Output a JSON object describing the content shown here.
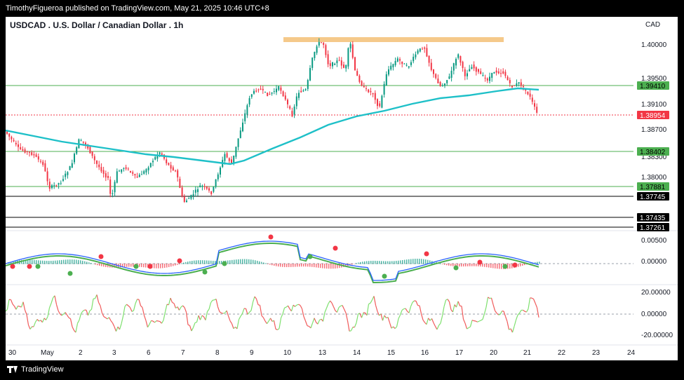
{
  "header": {
    "publisher_line": "TimothyFigueroa published on TradingView.com, May 21, 2025 10:46 UTC+8"
  },
  "chart": {
    "title": "USDCAD . U.S. Dollar / Canadian Dollar . 1h",
    "currency": "CAD",
    "price_ticks": [
      "1.40000",
      "1.39500",
      "1.39100",
      "1.38700",
      "1.38300",
      "1.38000"
    ],
    "level_labels": [
      {
        "text": "1.39410",
        "bg": "#4caf50",
        "fg": "#000000"
      },
      {
        "text": "1.38954",
        "bg": "#f23645",
        "fg": "#ffffff"
      },
      {
        "text": "1.38402",
        "bg": "#4caf50",
        "fg": "#000000"
      },
      {
        "text": "1.37881",
        "bg": "#4caf50",
        "fg": "#000000"
      },
      {
        "text": "1.37745",
        "bg": "#000000",
        "fg": "#ffffff"
      },
      {
        "text": "1.37435",
        "bg": "#000000",
        "fg": "#ffffff"
      },
      {
        "text": "1.37261",
        "bg": "#000000",
        "fg": "#ffffff"
      }
    ],
    "macd_ticks": [
      "0.00500",
      "0.00000"
    ],
    "osc_ticks": [
      "20.00000",
      "0.00000",
      "-20.00000"
    ],
    "time_labels": [
      "30",
      "May",
      "2",
      "3",
      "6",
      "7",
      "8",
      "9",
      "10",
      "13",
      "14",
      "15",
      "16",
      "17",
      "20",
      "21",
      "22",
      "23",
      "24"
    ]
  },
  "colors": {
    "bull": "#089981",
    "bear": "#f23645",
    "ma": "#1ec0c8",
    "zone": "#f5c98a",
    "macd_line": "#2962ff",
    "signal_line": "#4caf50"
  },
  "footer": {
    "brand": "TradingView"
  }
}
